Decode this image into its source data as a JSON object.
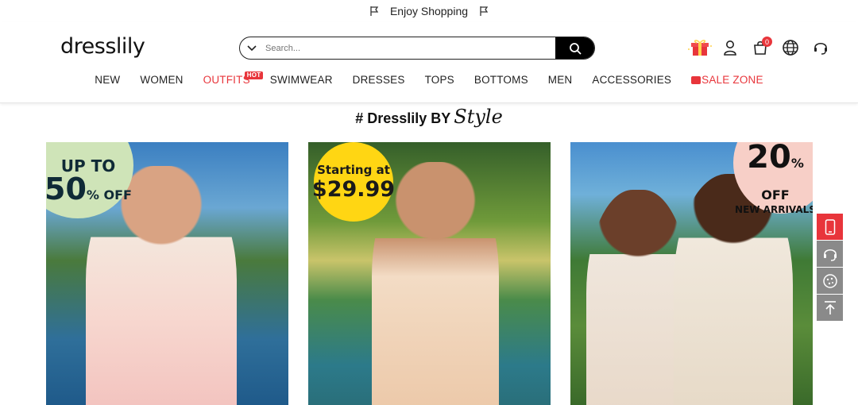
{
  "topbar": {
    "text": "Enjoy Shopping",
    "icon_left": "flag-icon",
    "icon_right": "flag-icon"
  },
  "header": {
    "logo": "dresslily",
    "search": {
      "placeholder": "Search..."
    },
    "cart_count": "0",
    "icons": [
      "gift-icon",
      "user-icon",
      "cart-icon",
      "globe-icon",
      "headset-icon"
    ]
  },
  "nav": {
    "items": [
      "NEW",
      "WOMEN",
      "OUTFITS",
      "SWIMWEAR",
      "DRESSES",
      "TOPS",
      "BOTTOMS",
      "MEN",
      "ACCESSORIES",
      "SALE ZONE"
    ],
    "hot_label": "HOT"
  },
  "section": {
    "title": "# Dresslily BY",
    "style_word": "Style"
  },
  "cards": [
    {
      "badge_line1": "UP TO",
      "badge_line2": "50",
      "badge_unit": "% OFF",
      "badge_color": "#cfe4b8"
    },
    {
      "badge_line1": "Starting at",
      "badge_line2": "$29.99",
      "badge_color": "#ffd613"
    },
    {
      "badge_line1": "20",
      "badge_unit": "% OFF",
      "badge_line2": "NEW ARRIVALS",
      "badge_color": "#f7cfc7"
    }
  ],
  "sidebar": [
    "mobile-icon",
    "headset-icon",
    "cookie-icon",
    "back-to-top-icon"
  ],
  "colors": {
    "accent": "#e8353b",
    "text": "#222222"
  }
}
